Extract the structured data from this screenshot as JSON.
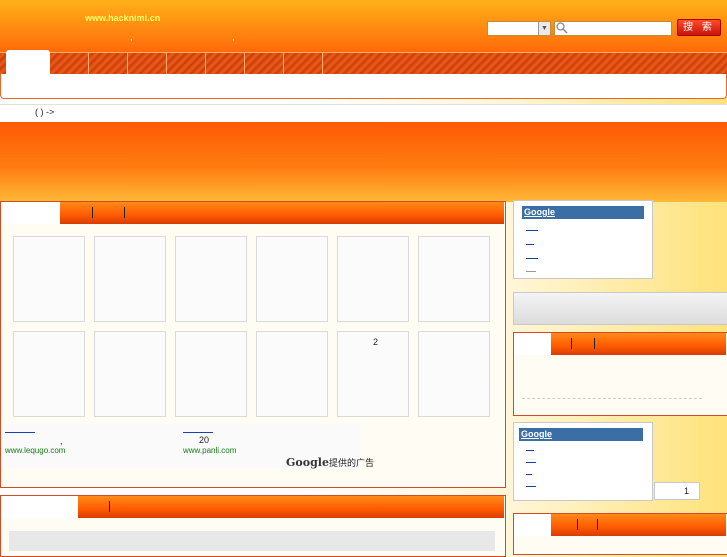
{
  "header": {
    "site_url": "www.hacknimi.cn",
    "dot1": ",",
    "dot2": ",",
    "search_button": "搜 索"
  },
  "breadcrumb": {
    "text": "( ) ->"
  },
  "main_panel": {
    "thumb_number": "2",
    "ads": {
      "ad1_dot": ",",
      "ad1_url": "www.lequgo.com",
      "ad2_num": "20",
      "ad2_url": "www.panli.com",
      "google_word": "Google",
      "google_suffix": "提供的广告"
    }
  },
  "right_column": {
    "google_box1": {
      "title": "Google"
    },
    "google_box2": {
      "title": "Google"
    },
    "count_box": "1"
  },
  "colors": {
    "header_orange": "#ff8a10",
    "nav_red": "#d9400c",
    "border_red": "#d24a26",
    "google_blue": "#3a6ea5",
    "link_blue": "#1a3fae",
    "url_green": "#147a14",
    "site_url_yellow": "#ffff66"
  },
  "icons": [
    "magnifier-icon",
    "dropdown-arrow-icon"
  ]
}
